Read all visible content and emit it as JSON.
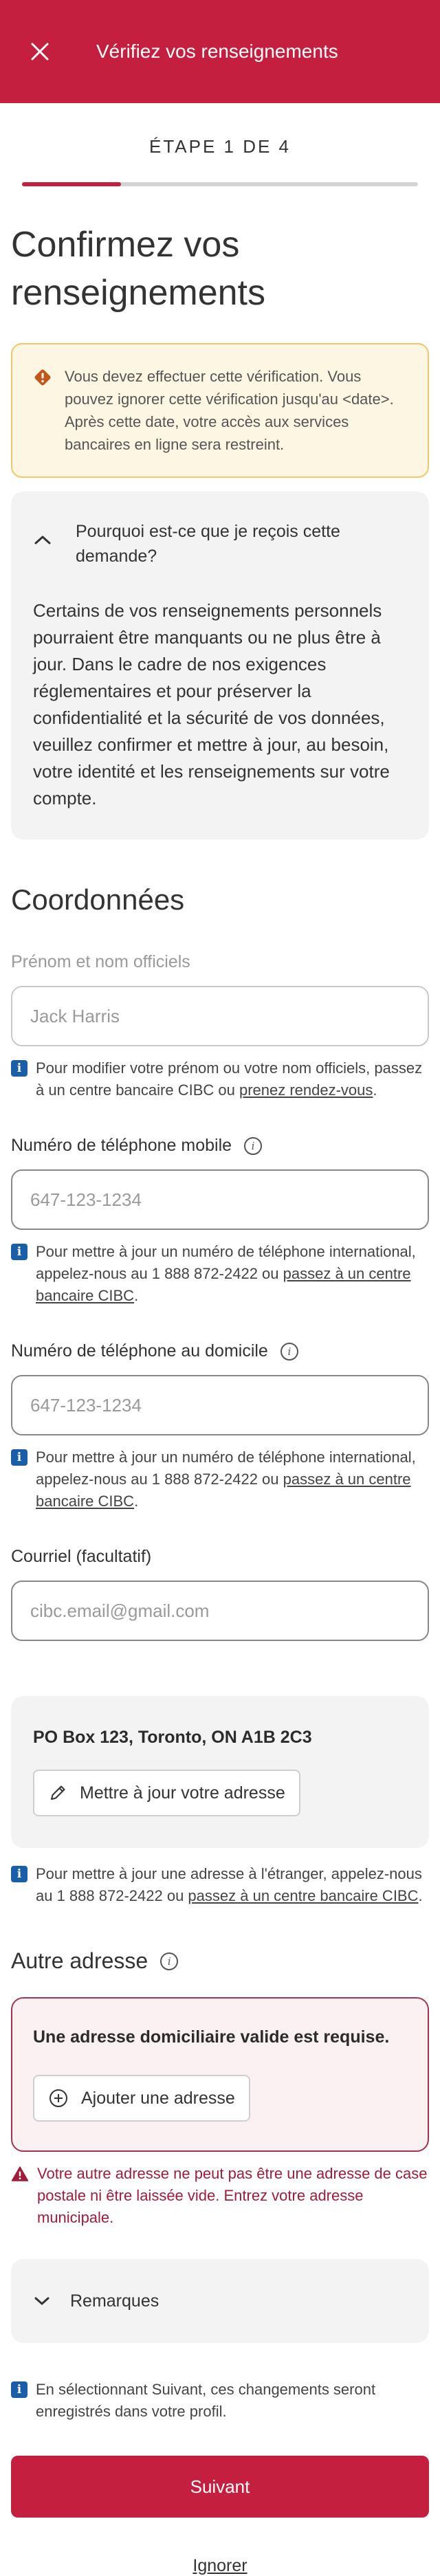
{
  "header": {
    "title": "Vérifiez vos renseignements"
  },
  "stepper": {
    "label": "ÉTAPE 1 DE 4",
    "progress_fraction": 0.25
  },
  "page_title": "Confirmez vos renseignements",
  "warning": {
    "text": "Vous devez effectuer cette vérification. Vous pouvez ignorer cette vérification jusqu'au <date>. Après cette date, votre accès aux services bancaires en ligne sera restreint."
  },
  "accordion": {
    "title": "Pourquoi est-ce que je reçois cette demande?",
    "body": "Certains de vos renseignements personnels pourraient être manquants ou ne plus être à jour. Dans le cadre de nos exigences réglementaires et pour préserver la confidentialité et la sécurité de vos données, veuillez confirmer et mettre à jour, au besoin, votre identité et les renseignements sur votre compte."
  },
  "contact": {
    "section_title": "Coordonnées",
    "legal_name": {
      "label": "Prénom et nom officiels",
      "value": "Jack Harris",
      "note_before": "Pour modifier votre prénom ou votre nom officiels, passez à un centre bancaire CIBC ou ",
      "note_link": "prenez rendez-vous",
      "note_after": "."
    },
    "mobile": {
      "label": "Numéro de téléphone mobile",
      "placeholder": "647-123-1234",
      "note_before": "Pour mettre à jour un numéro de téléphone international, appelez-nous au 1 888 872-2422 ou ",
      "note_link": "passez à un centre bancaire CIBC",
      "note_after": "."
    },
    "home": {
      "label": "Numéro de téléphone au domicile",
      "placeholder": "647-123-1234",
      "note_before": "Pour mettre à jour un numéro de téléphone international, appelez-nous au 1 888 872-2422 ou ",
      "note_link": "passez à un centre bancaire CIBC",
      "note_after": "."
    },
    "email": {
      "label": "Courriel (facultatif)",
      "placeholder": "cibc.email@gmail.com"
    }
  },
  "address": {
    "value": "PO Box 123, Toronto, ON A1B 2C3",
    "update_button": "Mettre à jour votre adresse",
    "note_before": "Pour mettre à jour une adresse à l'étranger, appelez-nous au 1 888 872-2422 ou ",
    "note_link": "passez à un centre bancaire CIBC",
    "note_after": "."
  },
  "other_address": {
    "label": "Autre adresse",
    "required_title": "Une adresse domiciliaire valide est requise.",
    "add_button": "Ajouter une adresse",
    "error": "Votre autre adresse ne peut pas être une adresse de case postale ni être laissée vide. Entrez votre adresse municipale."
  },
  "remarks": {
    "label": "Remarques"
  },
  "footer": {
    "note": "En sélectionnant Suivant, ces changements seront enregistrés dans votre profil.",
    "next_button": "Suivant",
    "skip_link": "Ignorer"
  },
  "colors": {
    "brand": "#c41f3e",
    "info": "#1a5ea8",
    "warning_bg": "#fdf6e3",
    "warning_border": "#f0c869",
    "error": "#a01c3b"
  }
}
